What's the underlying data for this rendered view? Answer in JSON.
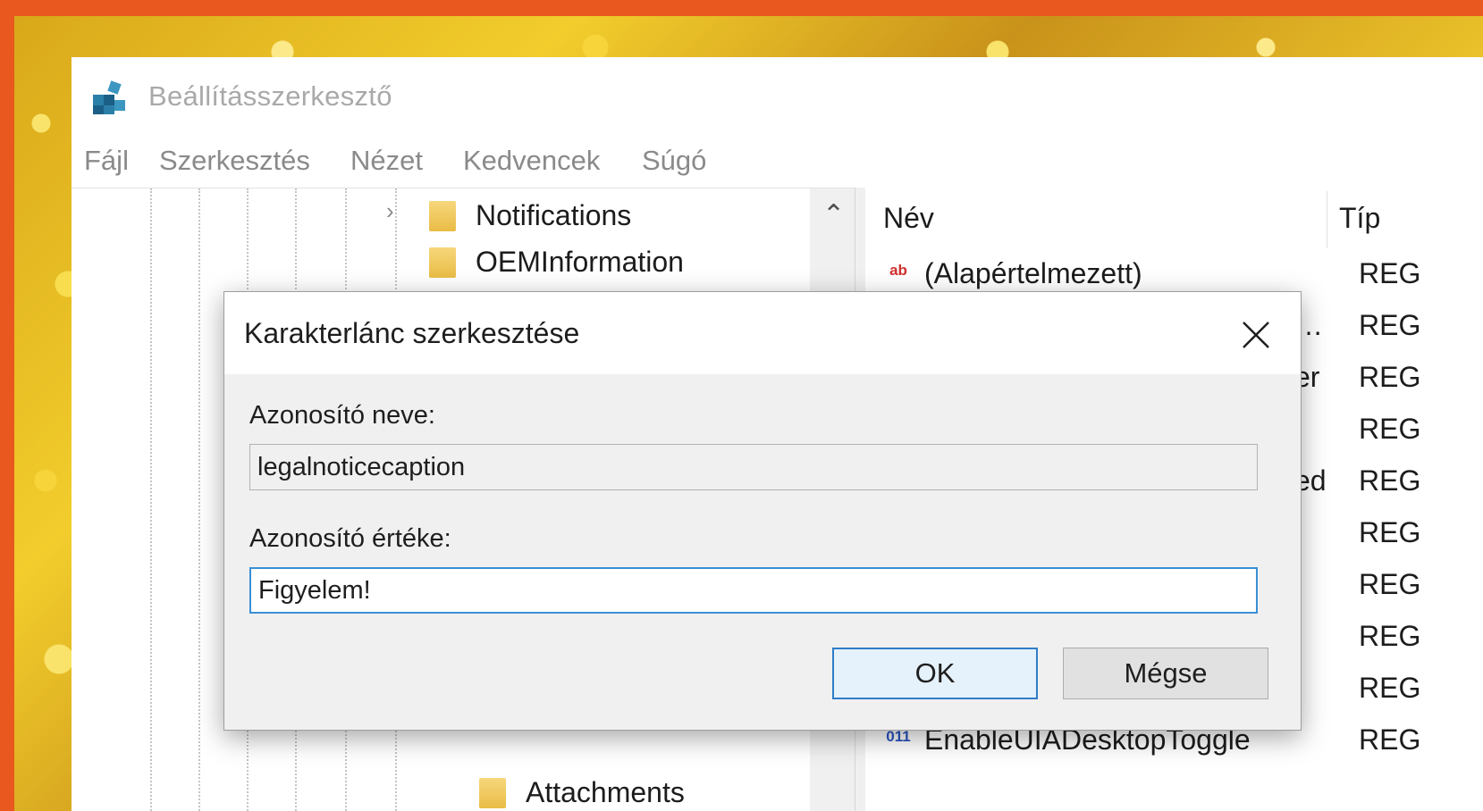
{
  "app": {
    "title": "Beállításszerkesztő",
    "icon": "registry-editor-icon"
  },
  "menu": [
    "Fájl",
    "Szerkesztés",
    "Nézet",
    "Kedvencek",
    "Súgó"
  ],
  "tree": {
    "items": [
      {
        "label": "Notifications",
        "expander": "›"
      },
      {
        "label": "OEMInformation"
      },
      {
        "label": "Attachments"
      }
    ]
  },
  "list": {
    "columns": {
      "name": "Név",
      "type": "Típ"
    },
    "rows": [
      {
        "name": "(Alapértelmezett)",
        "type": "REG",
        "icon": "string-value-icon"
      },
      {
        "name": "…",
        "type": "REG"
      },
      {
        "name": "er",
        "type": "REG"
      },
      {
        "name": "",
        "type": "REG"
      },
      {
        "name": "ed",
        "type": "REG"
      },
      {
        "name": "",
        "type": "REG"
      },
      {
        "name": "",
        "type": "REG"
      },
      {
        "name": "",
        "type": "REG"
      },
      {
        "name": "",
        "type": "REG"
      },
      {
        "name": "EnableUIADesktopToggle",
        "type": "REG",
        "icon": "dword-value-icon"
      }
    ]
  },
  "dialog": {
    "title": "Karakterlánc szerkesztése",
    "name_label": "Azonosító neve:",
    "name_value": "legalnoticecaption",
    "value_label": "Azonosító értéke:",
    "value_value": "Figyelem!",
    "ok_label": "OK",
    "cancel_label": "Mégse"
  }
}
